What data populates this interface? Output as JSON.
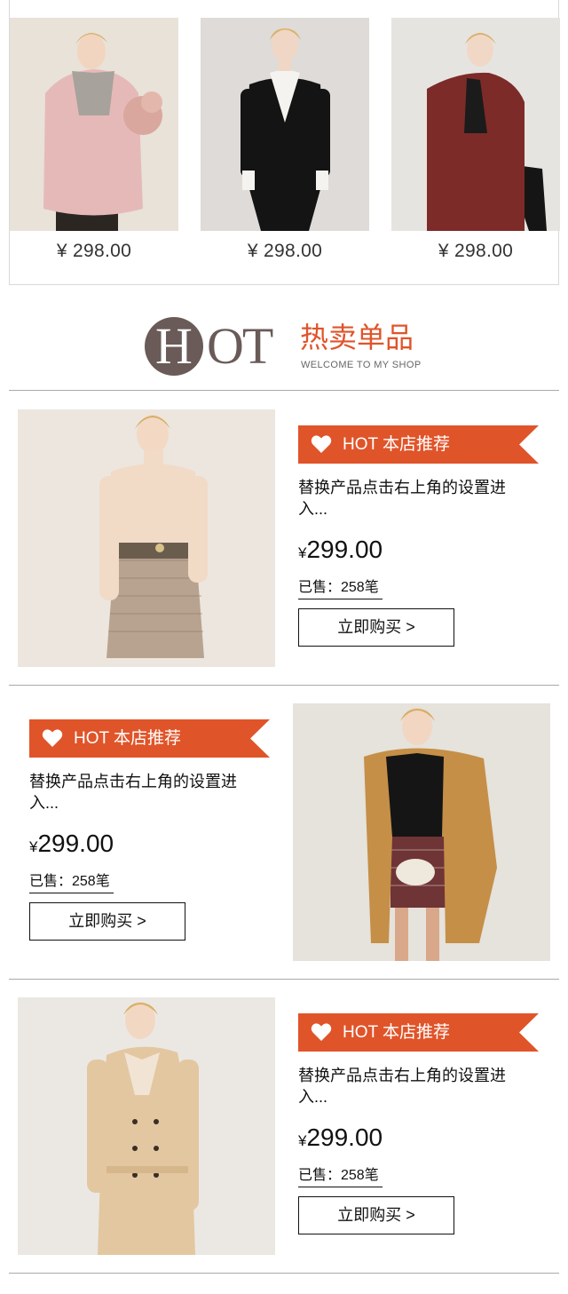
{
  "top_products": [
    {
      "price": "¥ 298.00",
      "photo_icon": "pink-down-jacket-photo"
    },
    {
      "price": "¥ 298.00",
      "photo_icon": "black-dress-photo"
    },
    {
      "price": "¥ 298.00",
      "photo_icon": "red-coat-photo"
    }
  ],
  "hot_header": {
    "letter_h": "H",
    "letters_ot": "OT",
    "title_cn": "热卖单品",
    "subtitle_en": "WELCOME TO MY SHOP"
  },
  "featured": [
    {
      "tag": "HOT 本店推荐",
      "description": "替换产品点击右上角的设置进入...",
      "currency": "¥",
      "price": "299.00",
      "sold": "已售：258笔",
      "buy_label": "立即购买 >",
      "photo_icon": "sweater-skirt-photo"
    },
    {
      "tag": "HOT 本店推荐",
      "description": "替换产品点击右上角的设置进入...",
      "currency": "¥",
      "price": "299.00",
      "sold": "已售：258笔",
      "buy_label": "立即购买 >",
      "photo_icon": "camel-coat-photo"
    },
    {
      "tag": "HOT 本店推荐",
      "description": "替换产品点击右上角的设置进入...",
      "currency": "¥",
      "price": "299.00",
      "sold": "已售：258笔",
      "buy_label": "立即购买 >",
      "photo_icon": "beige-trench-coat-photo"
    }
  ],
  "colors": {
    "accent": "#e0542a",
    "hot_brown": "#6a5b58"
  }
}
